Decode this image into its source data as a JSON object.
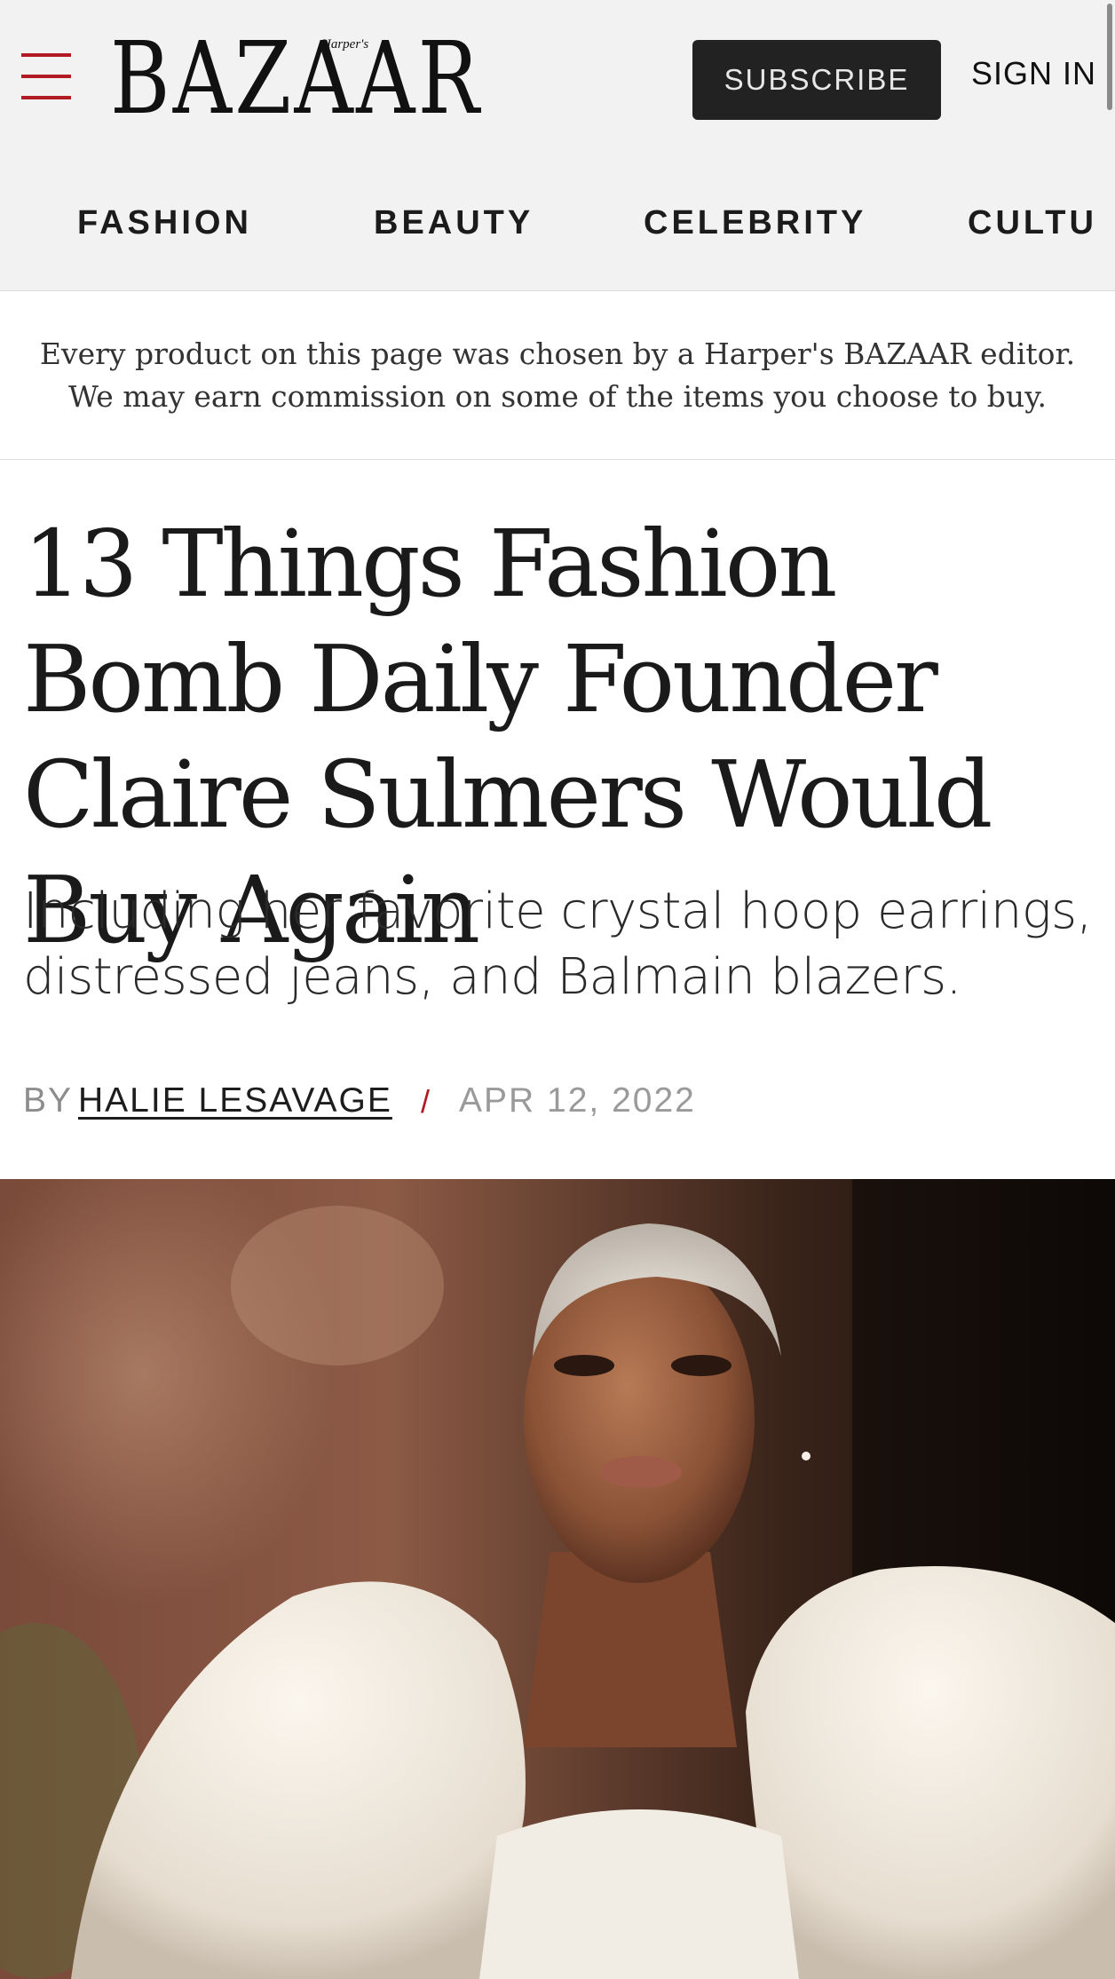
{
  "header": {
    "logo_text": "BAZAAR",
    "logo_sub": "Harper's",
    "subscribe_label": "SUBSCRIBE",
    "signin_label": "SIGN IN",
    "brand_color": "#b11a23"
  },
  "nav": {
    "items": [
      {
        "label": "FASHION"
      },
      {
        "label": "BEAUTY"
      },
      {
        "label": "CELEBRITY"
      },
      {
        "label": "CULTU"
      }
    ]
  },
  "disclosure": {
    "line1": "Every product on this page was chosen by a Harper's BAZAAR editor.",
    "line2": "We may earn commission on some of the items you choose to buy."
  },
  "article": {
    "title": "13 Things Fashion Bomb Daily Founder Claire Sulmers Would Buy Again",
    "dek": "Including her favorite crystal hoop earrings, distressed jeans, and Balmain blazers.",
    "byline_prefix": "BY",
    "author": "HALIE LESAVAGE",
    "separator": "/",
    "date": "APR 12, 2022"
  },
  "icons": {
    "menu": "hamburger-menu-icon"
  }
}
